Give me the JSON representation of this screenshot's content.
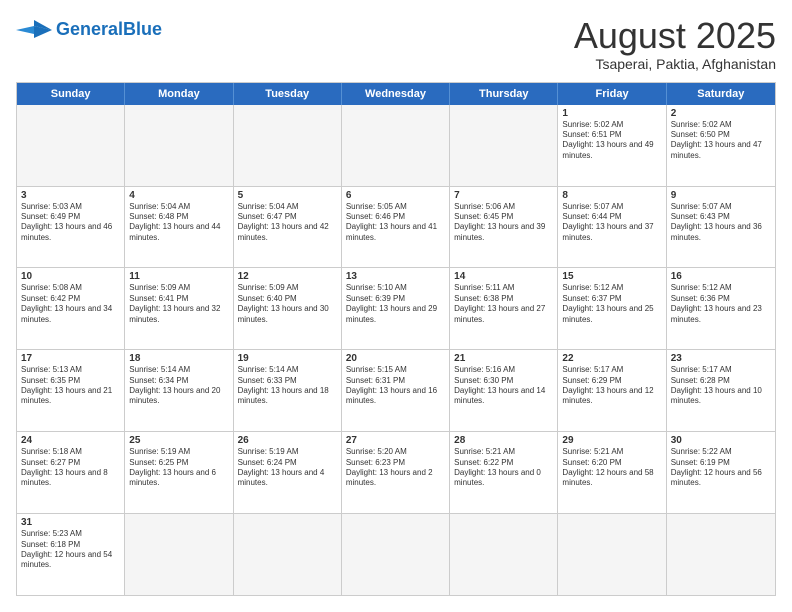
{
  "header": {
    "logo_general": "General",
    "logo_blue": "Blue",
    "month_title": "August 2025",
    "subtitle": "Tsaperai, Paktia, Afghanistan"
  },
  "days_of_week": [
    "Sunday",
    "Monday",
    "Tuesday",
    "Wednesday",
    "Thursday",
    "Friday",
    "Saturday"
  ],
  "weeks": [
    [
      {
        "day": "",
        "text": "",
        "empty": true
      },
      {
        "day": "",
        "text": "",
        "empty": true
      },
      {
        "day": "",
        "text": "",
        "empty": true
      },
      {
        "day": "",
        "text": "",
        "empty": true
      },
      {
        "day": "",
        "text": "",
        "empty": true
      },
      {
        "day": "1",
        "text": "Sunrise: 5:02 AM\nSunset: 6:51 PM\nDaylight: 13 hours and 49 minutes.",
        "empty": false
      },
      {
        "day": "2",
        "text": "Sunrise: 5:02 AM\nSunset: 6:50 PM\nDaylight: 13 hours and 47 minutes.",
        "empty": false
      }
    ],
    [
      {
        "day": "3",
        "text": "Sunrise: 5:03 AM\nSunset: 6:49 PM\nDaylight: 13 hours and 46 minutes.",
        "empty": false
      },
      {
        "day": "4",
        "text": "Sunrise: 5:04 AM\nSunset: 6:48 PM\nDaylight: 13 hours and 44 minutes.",
        "empty": false
      },
      {
        "day": "5",
        "text": "Sunrise: 5:04 AM\nSunset: 6:47 PM\nDaylight: 13 hours and 42 minutes.",
        "empty": false
      },
      {
        "day": "6",
        "text": "Sunrise: 5:05 AM\nSunset: 6:46 PM\nDaylight: 13 hours and 41 minutes.",
        "empty": false
      },
      {
        "day": "7",
        "text": "Sunrise: 5:06 AM\nSunset: 6:45 PM\nDaylight: 13 hours and 39 minutes.",
        "empty": false
      },
      {
        "day": "8",
        "text": "Sunrise: 5:07 AM\nSunset: 6:44 PM\nDaylight: 13 hours and 37 minutes.",
        "empty": false
      },
      {
        "day": "9",
        "text": "Sunrise: 5:07 AM\nSunset: 6:43 PM\nDaylight: 13 hours and 36 minutes.",
        "empty": false
      }
    ],
    [
      {
        "day": "10",
        "text": "Sunrise: 5:08 AM\nSunset: 6:42 PM\nDaylight: 13 hours and 34 minutes.",
        "empty": false
      },
      {
        "day": "11",
        "text": "Sunrise: 5:09 AM\nSunset: 6:41 PM\nDaylight: 13 hours and 32 minutes.",
        "empty": false
      },
      {
        "day": "12",
        "text": "Sunrise: 5:09 AM\nSunset: 6:40 PM\nDaylight: 13 hours and 30 minutes.",
        "empty": false
      },
      {
        "day": "13",
        "text": "Sunrise: 5:10 AM\nSunset: 6:39 PM\nDaylight: 13 hours and 29 minutes.",
        "empty": false
      },
      {
        "day": "14",
        "text": "Sunrise: 5:11 AM\nSunset: 6:38 PM\nDaylight: 13 hours and 27 minutes.",
        "empty": false
      },
      {
        "day": "15",
        "text": "Sunrise: 5:12 AM\nSunset: 6:37 PM\nDaylight: 13 hours and 25 minutes.",
        "empty": false
      },
      {
        "day": "16",
        "text": "Sunrise: 5:12 AM\nSunset: 6:36 PM\nDaylight: 13 hours and 23 minutes.",
        "empty": false
      }
    ],
    [
      {
        "day": "17",
        "text": "Sunrise: 5:13 AM\nSunset: 6:35 PM\nDaylight: 13 hours and 21 minutes.",
        "empty": false
      },
      {
        "day": "18",
        "text": "Sunrise: 5:14 AM\nSunset: 6:34 PM\nDaylight: 13 hours and 20 minutes.",
        "empty": false
      },
      {
        "day": "19",
        "text": "Sunrise: 5:14 AM\nSunset: 6:33 PM\nDaylight: 13 hours and 18 minutes.",
        "empty": false
      },
      {
        "day": "20",
        "text": "Sunrise: 5:15 AM\nSunset: 6:31 PM\nDaylight: 13 hours and 16 minutes.",
        "empty": false
      },
      {
        "day": "21",
        "text": "Sunrise: 5:16 AM\nSunset: 6:30 PM\nDaylight: 13 hours and 14 minutes.",
        "empty": false
      },
      {
        "day": "22",
        "text": "Sunrise: 5:17 AM\nSunset: 6:29 PM\nDaylight: 13 hours and 12 minutes.",
        "empty": false
      },
      {
        "day": "23",
        "text": "Sunrise: 5:17 AM\nSunset: 6:28 PM\nDaylight: 13 hours and 10 minutes.",
        "empty": false
      }
    ],
    [
      {
        "day": "24",
        "text": "Sunrise: 5:18 AM\nSunset: 6:27 PM\nDaylight: 13 hours and 8 minutes.",
        "empty": false
      },
      {
        "day": "25",
        "text": "Sunrise: 5:19 AM\nSunset: 6:25 PM\nDaylight: 13 hours and 6 minutes.",
        "empty": false
      },
      {
        "day": "26",
        "text": "Sunrise: 5:19 AM\nSunset: 6:24 PM\nDaylight: 13 hours and 4 minutes.",
        "empty": false
      },
      {
        "day": "27",
        "text": "Sunrise: 5:20 AM\nSunset: 6:23 PM\nDaylight: 13 hours and 2 minutes.",
        "empty": false
      },
      {
        "day": "28",
        "text": "Sunrise: 5:21 AM\nSunset: 6:22 PM\nDaylight: 13 hours and 0 minutes.",
        "empty": false
      },
      {
        "day": "29",
        "text": "Sunrise: 5:21 AM\nSunset: 6:20 PM\nDaylight: 12 hours and 58 minutes.",
        "empty": false
      },
      {
        "day": "30",
        "text": "Sunrise: 5:22 AM\nSunset: 6:19 PM\nDaylight: 12 hours and 56 minutes.",
        "empty": false
      }
    ],
    [
      {
        "day": "31",
        "text": "Sunrise: 5:23 AM\nSunset: 6:18 PM\nDaylight: 12 hours and 54 minutes.",
        "empty": false
      },
      {
        "day": "",
        "text": "",
        "empty": true
      },
      {
        "day": "",
        "text": "",
        "empty": true
      },
      {
        "day": "",
        "text": "",
        "empty": true
      },
      {
        "day": "",
        "text": "",
        "empty": true
      },
      {
        "day": "",
        "text": "",
        "empty": true
      },
      {
        "day": "",
        "text": "",
        "empty": true
      }
    ]
  ]
}
